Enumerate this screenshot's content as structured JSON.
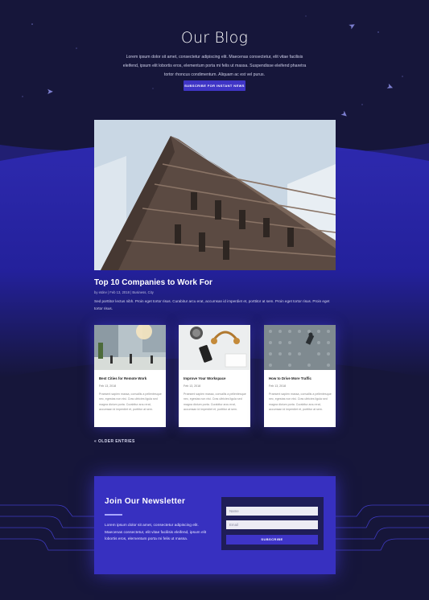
{
  "hero": {
    "title": "Our Blog",
    "intro": "Lorem ipsum dolor sit amet, consectetur adipiscing elit. Maecenas consectetur, elit vitae facilisis eleifend, ipsum elit lobortis eros, elementum porta mi felis ut massa. Suspendisse eleifend pharetra tortor rhoncus condimentum. Aliquam ac est vel purus.",
    "cta_label": "Subscribe for Instant News"
  },
  "featured": {
    "title": "Top 10 Companies to Work For",
    "meta": "by etdev | Feb 13, 2018 | Business, City",
    "excerpt": "Sed porttitor lectus nibh. Proin eget tortor risus. Curabitur arcu erat, accumsan id imperdiet et, porttitor at sem. Proin eget tortor risus. Proin eget tortor risus."
  },
  "posts": [
    {
      "title": "Best Cities for Remote Work",
      "date": "Feb 13, 2018",
      "excerpt": "Praesent sapien massa, convallis a pellentesque nec, egestas non nisi. Cras ultricies ligula sed magna dictum porta. Curabitur arcu erat, accumsan id imperdiet et, porttitor at sem."
    },
    {
      "title": "Improve Your Workspace",
      "date": "Feb 13, 2018",
      "excerpt": "Praesent sapien massa, convallis a pellentesque nec, egestas non nisi. Cras ultricies ligula sed magna dictum porta. Curabitur arcu erat, accumsan id imperdiet et, porttitor at sem."
    },
    {
      "title": "How to Drive More Traffic",
      "date": "Feb 13, 2018",
      "excerpt": "Praesent sapien massa, convallis a pellentesque nec, egestas non nisi. Cras ultricies ligula sed magna dictum porta. Curabitur arcu erat, accumsan id imperdiet et, porttitor at sem."
    }
  ],
  "pagination": {
    "older_label": "« Older Entries"
  },
  "newsletter": {
    "title": "Join Our Newsletter",
    "body": "Lorem ipsum dolor sit amet, consectetur adipiscing elit. Maecenas consectetur, elit vitae facilisis eleifend, ipsum elit lobortis eros, elementum porta mi felis ut massa.",
    "name_placeholder": "Name",
    "email_placeholder": "Email",
    "submit_label": "Subscribe"
  },
  "colors": {
    "background": "#16163a",
    "accent": "#3f35c6",
    "band": "#2a27a3"
  },
  "icons": [
    "paper-plane-icon"
  ]
}
